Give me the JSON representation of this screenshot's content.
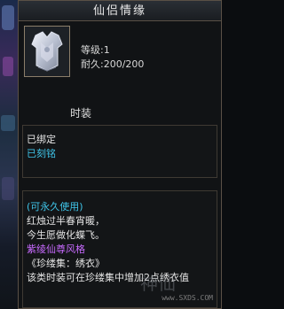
{
  "tooltip": {
    "title": "仙侣情缘",
    "stats": {
      "level": "等级:1",
      "durability": "耐久:200/200"
    },
    "item_type": "时装",
    "bind_lines": [
      "已绑定",
      "已刻铭"
    ],
    "desc_lines": [
      {
        "text": "(可永久使用)",
        "color": "#3fc4e8"
      },
      {
        "text": "红烛过半春宵暖，",
        "color": "#e4e4e4"
      },
      {
        "text": "今生愿做化蝶飞。",
        "color": "#e4e4e4"
      },
      {
        "text": "紫绫仙尊风格",
        "color": "#c86aff"
      },
      {
        "text": "《珍缕集：绣衣》",
        "color": "#e4e4e4"
      },
      {
        "text": "该类时装可在珍缕集中增加2点绣衣值",
        "color": "#e4e4e4"
      }
    ],
    "watermark": "www.SXDS.COM"
  },
  "icons": {
    "item_icon": "armor-icon"
  }
}
